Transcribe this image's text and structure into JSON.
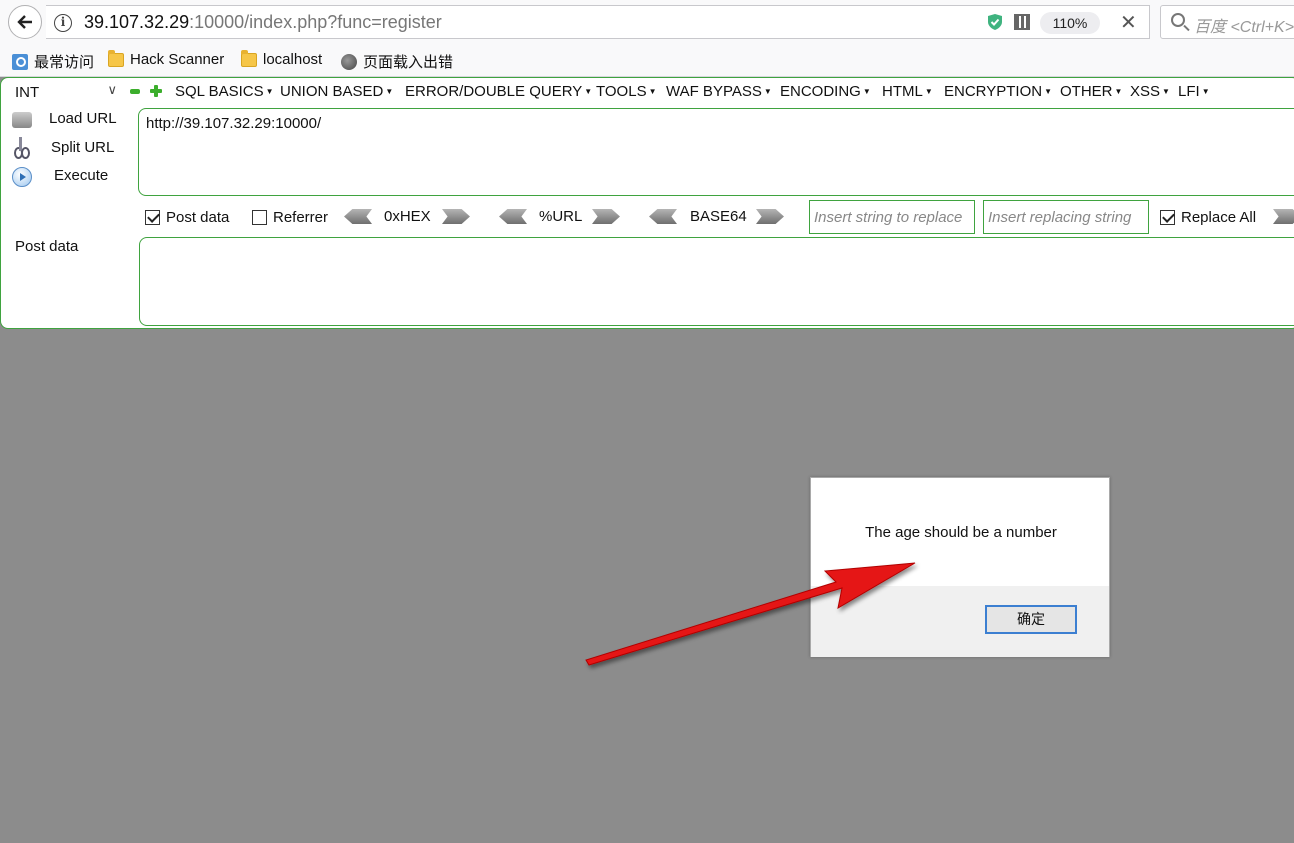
{
  "browser": {
    "url_host": "39.107.32.29",
    "url_rest": ":10000/index.php?func=register",
    "zoom": "110%",
    "search_placeholder": "百度 <Ctrl+K>"
  },
  "bookmarks": [
    {
      "label": "最常访问"
    },
    {
      "label": "Hack Scanner"
    },
    {
      "label": "localhost"
    },
    {
      "label": "页面载入出错"
    }
  ],
  "hackbar": {
    "type_select": "INT",
    "menus": [
      "SQL BASICS",
      "UNION BASED",
      "ERROR/DOUBLE QUERY",
      "TOOLS",
      "WAF BYPASS",
      "ENCODING",
      "HTML",
      "ENCRYPTION",
      "OTHER",
      "XSS",
      "LFI"
    ],
    "load_url": "Load URL",
    "split_url": "Split URL",
    "execute": "Execute",
    "url_value": "http://39.107.32.29:10000/",
    "post_data_check": "Post data",
    "referrer_check": "Referrer",
    "hex_label": "0xHEX",
    "url_label": "%URL",
    "base64_label": "BASE64",
    "replace_placeholder": "Insert string to replace",
    "replacing_placeholder": "Insert replacing string",
    "replace_all": "Replace All",
    "post_data_label": "Post data",
    "post_data_value": ""
  },
  "dialog": {
    "message": "The age should be a number",
    "ok_label": "确定"
  },
  "colors": {
    "hackbar_border": "#3fa33f",
    "annotation_arrow": "#e51414",
    "backdrop": "#8c8c8c"
  }
}
